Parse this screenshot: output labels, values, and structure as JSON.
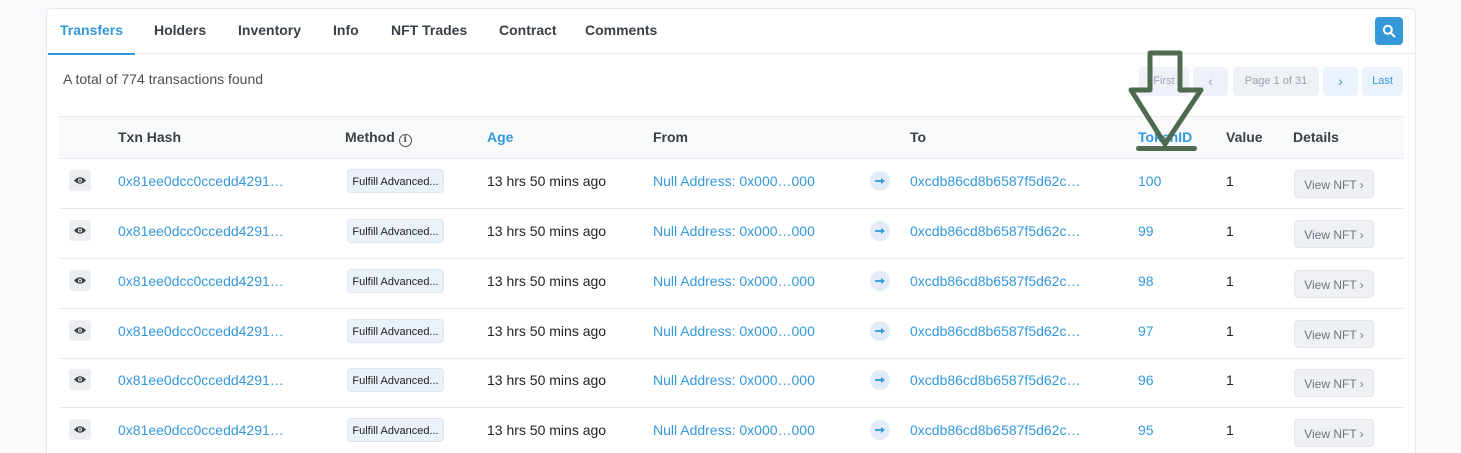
{
  "tabs": [
    {
      "label": "Transfers"
    },
    {
      "label": "Holders"
    },
    {
      "label": "Inventory"
    },
    {
      "label": "Info"
    },
    {
      "label": "NFT Trades"
    },
    {
      "label": "Contract"
    },
    {
      "label": "Comments"
    }
  ],
  "summary": "A total of 774 transactions found",
  "pagination": {
    "first": "First",
    "prev": "‹",
    "page": "Page 1 of 31",
    "next": "›",
    "last": "Last"
  },
  "columns": {
    "txn_hash": "Txn Hash",
    "method": "Method",
    "age": "Age",
    "from": "From",
    "to": "To",
    "token_id": "TokenID",
    "value": "Value",
    "details": "Details"
  },
  "rows": [
    {
      "hash": "0x81ee0dcc0ccedd4291…",
      "method": "Fulfill Advanced...",
      "age": "13 hrs 50 mins ago",
      "from": "Null Address: 0x000…000",
      "to": "0xcdb86cd8b6587f5d62c…",
      "token_id": "100",
      "value": "1",
      "details": "View NFT ›"
    },
    {
      "hash": "0x81ee0dcc0ccedd4291…",
      "method": "Fulfill Advanced...",
      "age": "13 hrs 50 mins ago",
      "from": "Null Address: 0x000…000",
      "to": "0xcdb86cd8b6587f5d62c…",
      "token_id": "99",
      "value": "1",
      "details": "View NFT ›"
    },
    {
      "hash": "0x81ee0dcc0ccedd4291…",
      "method": "Fulfill Advanced...",
      "age": "13 hrs 50 mins ago",
      "from": "Null Address: 0x000…000",
      "to": "0xcdb86cd8b6587f5d62c…",
      "token_id": "98",
      "value": "1",
      "details": "View NFT ›"
    },
    {
      "hash": "0x81ee0dcc0ccedd4291…",
      "method": "Fulfill Advanced...",
      "age": "13 hrs 50 mins ago",
      "from": "Null Address: 0x000…000",
      "to": "0xcdb86cd8b6587f5d62c…",
      "token_id": "97",
      "value": "1",
      "details": "View NFT ›"
    },
    {
      "hash": "0x81ee0dcc0ccedd4291…",
      "method": "Fulfill Advanced...",
      "age": "13 hrs 50 mins ago",
      "from": "Null Address: 0x000…000",
      "to": "0xcdb86cd8b6587f5d62c…",
      "token_id": "96",
      "value": "1",
      "details": "View NFT ›"
    },
    {
      "hash": "0x81ee0dcc0ccedd4291…",
      "method": "Fulfill Advanced...",
      "age": "13 hrs 50 mins ago",
      "from": "Null Address: 0x000…000",
      "to": "0xcdb86cd8b6587f5d62c…",
      "token_id": "95",
      "value": "1",
      "details": "View NFT ›"
    }
  ],
  "colors": {
    "accent": "#3498db",
    "annotation": "#4f6b4f"
  },
  "icons": {
    "search": "search-icon",
    "eye": "eye-icon",
    "arrow": "arrow-right-icon",
    "info": "info-icon",
    "annotation": "down-arrow-annotation"
  }
}
